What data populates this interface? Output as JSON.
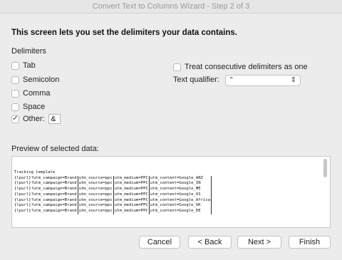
{
  "window": {
    "title": "Convert Text to Columns Wizard - Step 2 of 3"
  },
  "heading": "This screen lets you set the delimiters your data contains.",
  "delimiters": {
    "label": "Delimiters",
    "tab": {
      "label": "Tab",
      "checked": false
    },
    "semicolon": {
      "label": "Semicolon",
      "checked": false
    },
    "comma": {
      "label": "Comma",
      "checked": false
    },
    "space": {
      "label": "Space",
      "checked": false
    },
    "other": {
      "label": "Other:",
      "checked": true,
      "value": "&"
    }
  },
  "consecutive": {
    "label": "Treat consecutive delimiters as one",
    "checked": false
  },
  "qualifier": {
    "label": "Text qualifier:",
    "value": "\""
  },
  "preview": {
    "label": "Preview of selected data:",
    "rows": [
      [
        "Tracking template",
        "",
        "",
        ""
      ],
      [
        "{lpurl}?utm_campaign=Brand",
        "utm_source=ppc",
        "utm_medium=PPC",
        "utm_content=Google_ANZ"
      ],
      [
        "{lpurl}?utm_campaign=Brand",
        "utm_source=ppc",
        "utm_medium=PPC",
        "utm_content=Google_IN"
      ],
      [
        "{lpurl}?utm_campaign=Brand",
        "utm_source=ppc",
        "utm_medium=PPC",
        "utm_content=Google_ME"
      ],
      [
        "{lpurl}?utm_campaign=Brand",
        "utm_source=ppc",
        "utm_medium=PPC",
        "utm_content=Google_US"
      ],
      [
        "{lpurl}?utm_campaign=Brand",
        "utm_source=ppc",
        "utm_medium=PPC",
        "utm_content=Google_Africa"
      ],
      [
        "{lpurl}?utm_campaign=Brand",
        "utm_source=ppc",
        "utm_medium=PPC",
        "utm_content=Google_UK"
      ],
      [
        "{lpurl}?utm_campaign=Brand",
        "utm_source=ppc",
        "utm_medium=PPC",
        "utm_content=Google_DE"
      ]
    ]
  },
  "buttons": {
    "cancel": "Cancel",
    "back": "< Back",
    "next": "Next >",
    "finish": "Finish"
  }
}
